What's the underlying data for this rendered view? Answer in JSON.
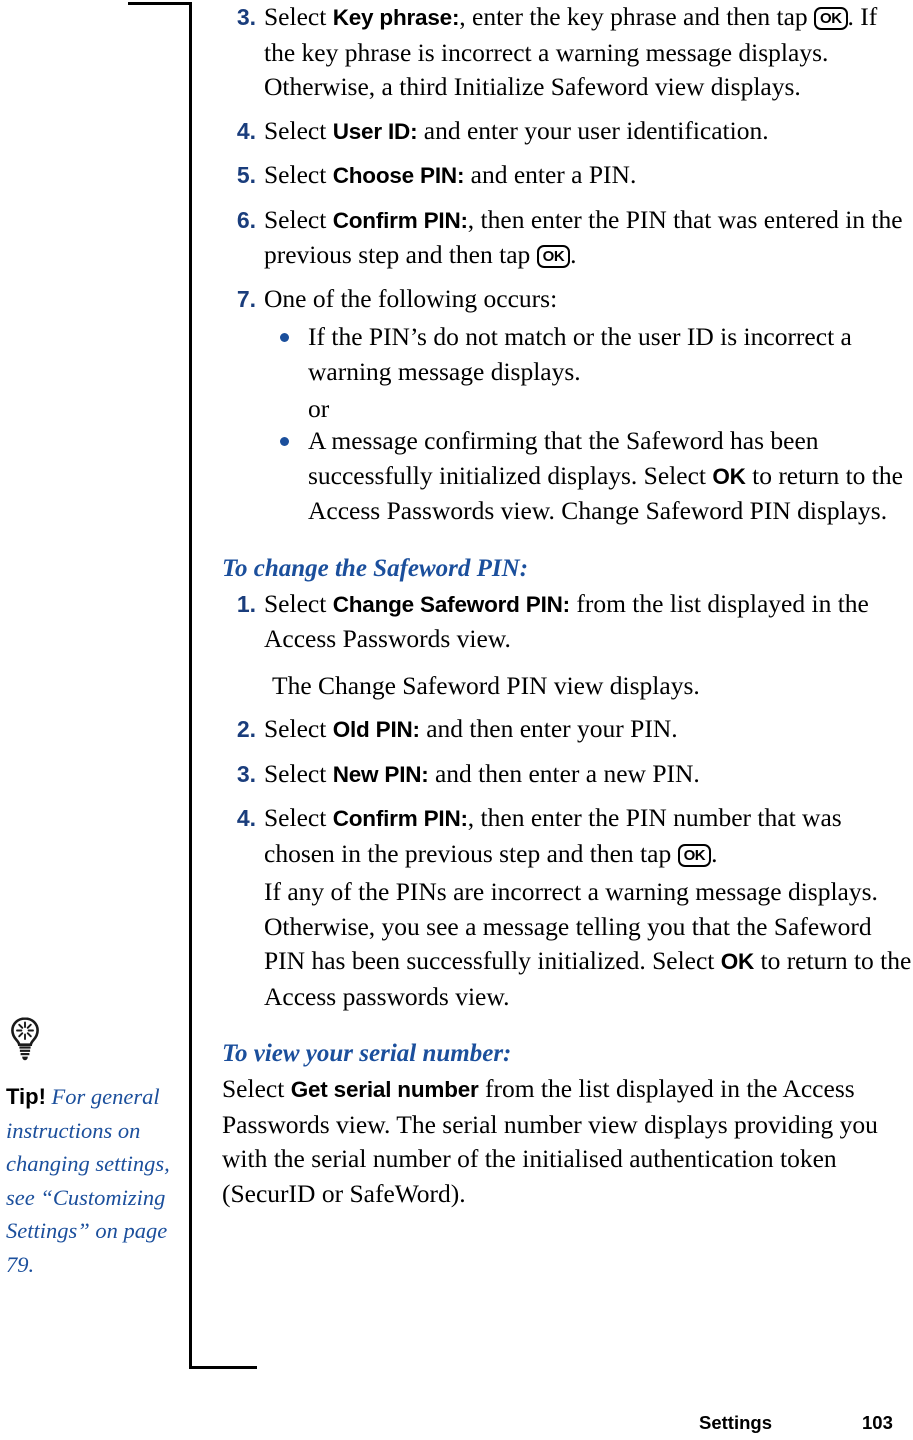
{
  "page": {
    "footer_section": "Settings",
    "footer_page_number": "103",
    "accent_blue": "#1b4f9c",
    "step_number_blue": "#1a3d7c",
    "text_black": "#000000"
  },
  "sidebar": {
    "icon": "lightbulb-icon",
    "tip_lead": "Tip!",
    "tip_text": " For general instructions on changing settings, see “Customizing Settings” on page 79."
  },
  "initialize_steps": [
    {
      "num": "3.",
      "parts": [
        {
          "t": "text",
          "v": "Select "
        },
        {
          "t": "label",
          "v": "Key phrase:"
        },
        {
          "t": "text",
          "v": ", enter the key phrase and then tap "
        },
        {
          "t": "key",
          "v": "OK"
        },
        {
          "t": "text",
          "v": ". If the key phrase is incorrect a warning message displays. Otherwise, a third Initialize Safeword view displays."
        }
      ]
    },
    {
      "num": "4.",
      "parts": [
        {
          "t": "text",
          "v": "Select "
        },
        {
          "t": "label",
          "v": "User ID:"
        },
        {
          "t": "text",
          "v": " and enter your user identification."
        }
      ]
    },
    {
      "num": "5.",
      "parts": [
        {
          "t": "text",
          "v": "Select "
        },
        {
          "t": "label",
          "v": "Choose PIN:"
        },
        {
          "t": "text",
          "v": " and enter a PIN."
        }
      ]
    },
    {
      "num": "6.",
      "parts": [
        {
          "t": "text",
          "v": "Select "
        },
        {
          "t": "label",
          "v": "Confirm PIN:"
        },
        {
          "t": "text",
          "v": ", then enter the PIN that was entered in the previous step and then tap "
        },
        {
          "t": "key",
          "v": "OK"
        },
        {
          "t": "text",
          "v": "."
        }
      ]
    },
    {
      "num": "7.",
      "parts": [
        {
          "t": "text",
          "v": "One of the following occurs:"
        }
      ]
    }
  ],
  "bullets": [
    {
      "parts": [
        {
          "t": "text",
          "v": "If the PIN’s do not match or the user ID is incorrect a warning message displays."
        }
      ]
    },
    {
      "parts": [
        {
          "t": "text",
          "v": "A message confirming that the Safeword has been successfully initialized displays. Select "
        },
        {
          "t": "label",
          "v": "OK"
        },
        {
          "t": "text",
          "v": " to return to the Access Passwords view. Change Safeword PIN displays."
        }
      ]
    }
  ],
  "or_separator": "or",
  "change_pin": {
    "heading": "To change the Safeword PIN:",
    "steps": [
      {
        "num": "1.",
        "parts": [
          {
            "t": "text",
            "v": "Select "
          },
          {
            "t": "label",
            "v": "Change Safeword PIN:"
          },
          {
            "t": "text",
            "v": " from the list displayed in the Access Passwords view."
          }
        ],
        "note": "The Change Safeword PIN view displays."
      },
      {
        "num": "2.",
        "parts": [
          {
            "t": "text",
            "v": "Select "
          },
          {
            "t": "label",
            "v": "Old PIN:"
          },
          {
            "t": "text",
            "v": " and then enter your PIN."
          }
        ]
      },
      {
        "num": "3.",
        "parts": [
          {
            "t": "text",
            "v": "Select "
          },
          {
            "t": "label",
            "v": "New PIN:"
          },
          {
            "t": "text",
            "v": " and then enter a new PIN."
          }
        ]
      },
      {
        "num": "4.",
        "parts": [
          {
            "t": "text",
            "v": "Select "
          },
          {
            "t": "label",
            "v": "Confirm PIN:"
          },
          {
            "t": "text",
            "v": ", then enter the PIN number that was chosen in the previous step and then tap "
          },
          {
            "t": "key",
            "v": "OK"
          },
          {
            "t": "text",
            "v": "."
          }
        ],
        "note_parts": [
          {
            "t": "text",
            "v": "If any of the PINs are incorrect a warning message displays. Otherwise, you see a message telling you that the Safeword PIN has been successfully initialized. Select "
          },
          {
            "t": "label",
            "v": "OK"
          },
          {
            "t": "text",
            "v": " to return to the Access passwords view."
          }
        ]
      }
    ]
  },
  "serial_number": {
    "heading": "To view your serial number:",
    "parts": [
      {
        "t": "text",
        "v": "Select "
      },
      {
        "t": "label",
        "v": "Get serial number"
      },
      {
        "t": "text",
        "v": " from the list displayed in the Access Passwords view. The serial number view displays providing you with the serial number of the initialised authentication token (SecurID or SafeWord)."
      }
    ]
  }
}
